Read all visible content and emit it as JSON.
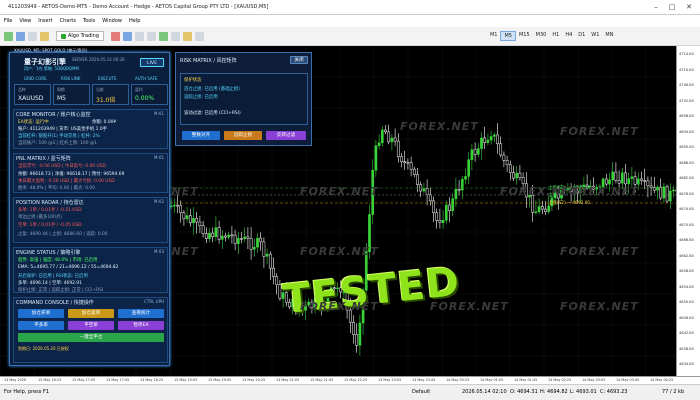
{
  "window": {
    "title": "411203949 - AETOS-Demo-MT5 - Demo Account - Hedge - AETOS Capital Group PTY LTD - [XAUUSD,M5]"
  },
  "menu": [
    "File",
    "View",
    "Insert",
    "Charts",
    "Tools",
    "Window",
    "Help"
  ],
  "toolbar": {
    "algo_label": "Algo Trading",
    "timeframes": [
      "M1",
      "M5",
      "M15",
      "M30",
      "H1",
      "H4",
      "D1",
      "W1",
      "MN"
    ],
    "active_tf": "M5"
  },
  "chart": {
    "label": "XAUUSD, M5:  SPOT GOLD (美元/盎司)",
    "price_labels": [
      "4714.80",
      "4710.80",
      "4706.80",
      "4702.80",
      "4698.80",
      "4694.80",
      "4690.80",
      "4686.80",
      "4682.80",
      "4678.80",
      "4674.80",
      "4670.80",
      "4666.80",
      "4662.80",
      "4658.80",
      "4654.80",
      "4650.80",
      "4646.80",
      "4642.80",
      "4638.80",
      "4634.80"
    ],
    "time_labels": [
      "13 May 2026",
      "13 May 16:25",
      "13 May 17:05",
      "13 May 17:45",
      "13 May 18:25",
      "13 May 19:05",
      "13 May 19:45",
      "13 May 20:25",
      "13 May 21:05",
      "13 May 21:45",
      "13 May 22:25",
      "13 May 23:05",
      "13 May 23:45",
      "14 May 00:25",
      "14 May 01:05",
      "14 May 01:45",
      "14 May 02:25",
      "14 May 03:05",
      "14 May 03:45",
      "14 May 04:25"
    ],
    "line_labels": {
      "top": "止损(S3) → 4696.14",
      "mid": "止损",
      "low": "止损(S2) → 4692.91"
    },
    "stamp": "TESTED",
    "watermark": "FOREX.NET",
    "colors": {
      "bull": "#39d139",
      "bear": "#ffffff",
      "background": "#000000"
    }
  },
  "panel": {
    "title": "量子幻影引擎",
    "server": "SERVER 2026.05.14 06:36",
    "user": "用户: 飞鸟  策略: 5QBQBQMM",
    "live": "LIVE",
    "flags": [
      "GRID CORE",
      "RISK LINK",
      "EXECUTE",
      "AUTH SAFE"
    ],
    "status_row": {
      "symbol": "XAUUSD",
      "tf": "M5",
      "mult": "31.0倍",
      "pct": "0.00%"
    },
    "status_heads": [
      "品种",
      "周期",
      "当前",
      "盈利"
    ],
    "core": {
      "title": "CORE MONITOR / 账户核心监控",
      "tag": "M-01",
      "l1": "EA状态: 运行中",
      "l1b": "余额: 0.00¥",
      "l2": "账户: 411203949 | 货币: US美金手机 1.0手",
      "l3": "当前杠杆: 银股开(1) 手动交易 | 杠杆: 2%",
      "l4": "当前账户: 100 @1 | 杠杆上限: 100 @1"
    },
    "pnl": {
      "title": "PNL MATRIX / 盈亏矩阵",
      "tag": "M-01",
      "l1": "当前浮亏: -0.56 USD | 今日盈亏: 0.00 USD",
      "l2": "余额: 96618.73 | 净值: 96618.17 | 预付: 96594.69",
      "l3": "本日最大盈利: -0.56 USD | 最大亏损: 0.00 USD",
      "l4": "胜率: 48.0% | 平均: 0.00 | 最大: 0.00"
    },
    "position": {
      "title": "POSITION RADAR / 持仓雷达",
      "tag": "M-02",
      "l1": "多单: 1单 / 0.01手 / -0.51 USD",
      "l2": "空单: 1单 / 0.01手 / -0.05 USD",
      "l3": "单边止损 (最多100点)",
      "l4": "空单: 1单 / 0.01手 / -0.05 USD",
      "l5": "止盈: 4690.44 | 止损: 4686.60 | 追踪: 0.00"
    },
    "engine": {
      "title": "ENGINE STATUS / 策略引擎",
      "tag": "M-03",
      "l1": "趋势: 高强 | 强度: 48.0% | 市场: 已启用",
      "l2": "EMA: 5=4695.77 / 21=4696.12 / 55=4694.82",
      "l3": "开启保护: 已启用 | RSI状态: 已启用",
      "l4": "多单: 4696.14 | 空单: 4692.91",
      "l5": "保护止损: 正常 | 追踪止损: 正常 | CCI+RSI"
    },
    "console": {
      "title": "COMMAND CONSOLE / 快捷操作",
      "tag": "CTRL UPH",
      "buttons": [
        "加仓买单",
        "加仓卖单",
        "查看统计",
        "平多单",
        "平空单",
        "暂停EA"
      ],
      "close_all": "一键全平仓",
      "footer": "到期日: 2026.05.20 已授权"
    }
  },
  "risk": {
    "title": "RISK MATRIX / 风控矩阵",
    "toggle": "关闭",
    "section": "保护状态",
    "l1": "首仓止损: 已启用 (基础止损)",
    "l2": "追踪止损: 已启用",
    "l3": "波动过滤: 已启用 (CCI+RSI)",
    "buttons": [
      "整数对齐",
      "追踪止损",
      "反转过滤"
    ]
  },
  "status": {
    "help": "For Help, press F1",
    "profile": "Default",
    "time": "2026.05.14 02:10",
    "o": "O: 4694.31",
    "h": "H: 4694.82",
    "l": "L: 4693.01",
    "c": "C: 4693.23",
    "traffic": "77 / 2 kb"
  }
}
